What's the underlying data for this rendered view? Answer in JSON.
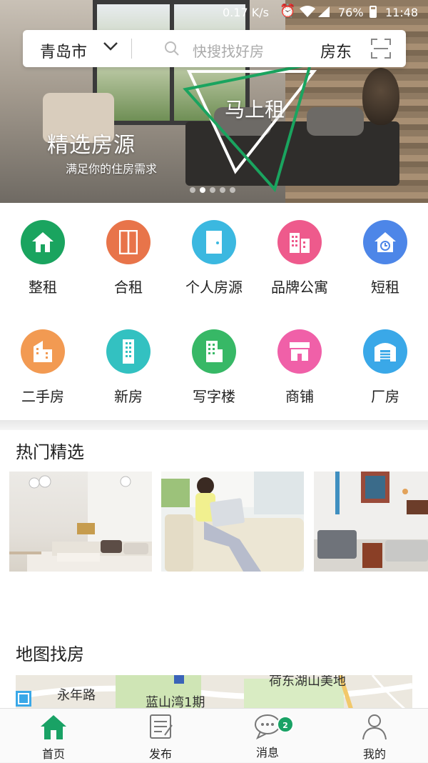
{
  "status_bar": {
    "speed": "0.17 K/s",
    "battery": "76%",
    "time": "11:48"
  },
  "search": {
    "city": "青岛市",
    "placeholder": "快搜找好房",
    "landlord": "房东"
  },
  "banner": {
    "headline": "精选房源",
    "subline": "满足你的住房需求",
    "badge": "马上租",
    "active_dot": 1,
    "dot_count": 5
  },
  "categories": [
    {
      "label": "整租",
      "icon": "house-icon",
      "color": "#1aa45f"
    },
    {
      "label": "合租",
      "icon": "door-icon",
      "color": "#e8744a"
    },
    {
      "label": "个人房源",
      "icon": "single-door-icon",
      "color": "#3bb8e0"
    },
    {
      "label": "品牌公寓",
      "icon": "apartment-icon",
      "color": "#ee5a8c"
    },
    {
      "label": "短租",
      "icon": "clock-house-icon",
      "color": "#4d86e8"
    },
    {
      "label": "二手房",
      "icon": "building-icon",
      "color": "#f29a52"
    },
    {
      "label": "新房",
      "icon": "tower-icon",
      "color": "#33c1c1"
    },
    {
      "label": "写字楼",
      "icon": "office-icon",
      "color": "#37b866"
    },
    {
      "label": "商铺",
      "icon": "shop-icon",
      "color": "#f060a8"
    },
    {
      "label": "厂房",
      "icon": "factory-icon",
      "color": "#3aa8e8"
    }
  ],
  "hot": {
    "title": "热门精选"
  },
  "map": {
    "title": "地图找房",
    "labels": [
      "永年路",
      "蓝山湾1期",
      "荷东湖山美地"
    ]
  },
  "nav": [
    {
      "label": "首页",
      "icon": "home-icon",
      "active": true
    },
    {
      "label": "发布",
      "icon": "publish-icon"
    },
    {
      "label": "消息",
      "icon": "message-icon",
      "badge": "2"
    },
    {
      "label": "我的",
      "icon": "profile-icon"
    }
  ],
  "colors": {
    "accent": "#19a265"
  }
}
